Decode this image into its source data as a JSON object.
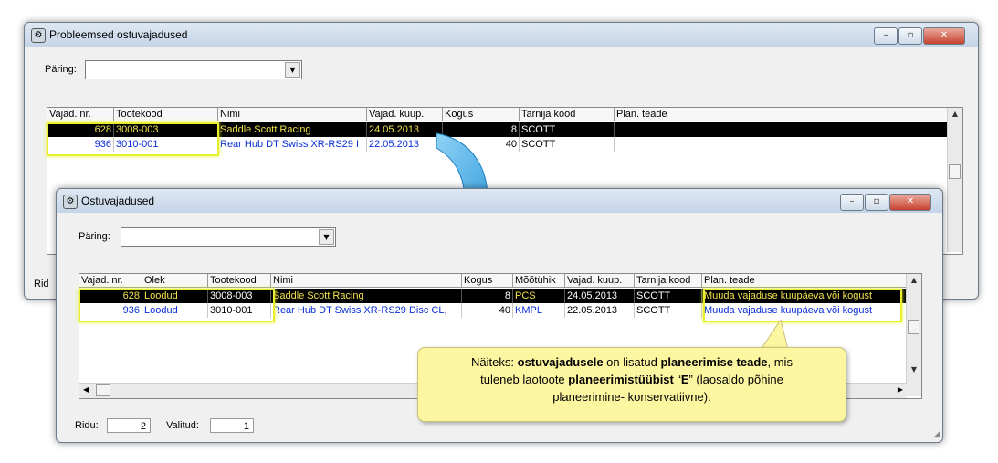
{
  "back_window": {
    "title": "Probleemsed ostuvajadused",
    "query_label": "Päring:",
    "query_value": "",
    "columns": [
      "Vajad. nr.",
      "Tootekood",
      "Nimi",
      "Vajad. kuup.",
      "Kogus",
      "Tarnija kood",
      "Plan. teade"
    ],
    "rows": [
      {
        "nr": "628",
        "code": "3008-003",
        "name": "Saddle Scott Racing",
        "date": "24.05.2013",
        "qty": "8",
        "supplier": "SCOTT",
        "plan": ""
      },
      {
        "nr": "936",
        "code": "3010-001",
        "name": "Rear Hub DT Swiss XR-RS29 I",
        "date": "22.05.2013",
        "qty": "40",
        "supplier": "SCOTT",
        "plan": ""
      }
    ],
    "status_label": "Rid"
  },
  "front_window": {
    "title": "Ostuvajadused",
    "query_label": "Päring:",
    "query_value": "",
    "columns": [
      "Vajad. nr.",
      "Olek",
      "Tootekood",
      "Nimi",
      "Kogus",
      "Mõõtühik",
      "Vajad. kuup.",
      "Tarnija kood",
      "Plan. teade"
    ],
    "rows": [
      {
        "nr": "628",
        "state": "Loodud",
        "code": "3008-003",
        "name": "Saddle Scott Racing",
        "qty": "8",
        "unit": "PCS",
        "date": "24.05.2013",
        "supplier": "SCOTT",
        "plan": "Muuda vajaduse kuupäeva või kogust"
      },
      {
        "nr": "936",
        "state": "Loodud",
        "code": "3010-001",
        "name": "Rear Hub DT Swiss XR-RS29 Disc CL,",
        "qty": "40",
        "unit": "KMPL",
        "date": "22.05.2013",
        "supplier": "SCOTT",
        "plan": "Muuda vajaduse kuupäeva või kogust"
      }
    ],
    "status": {
      "rows_label": "Ridu:",
      "rows_value": "2",
      "selected_label": "Valitud:",
      "selected_value": "1"
    }
  },
  "window_controls": {
    "minimize": "–",
    "maximize": "▫",
    "close": "✕"
  },
  "callout": {
    "line1_pre": "Näiteks: ",
    "line1_b1": "ostuvajadusele",
    "line1_mid": " on lisatud ",
    "line1_b2": "planeerimise teade",
    "line1_post": ", mis",
    "line2_pre": "tuleneb laotoote ",
    "line2_b1": "planeerimistüübist",
    "line2_q1": " “",
    "line2_b2": "E",
    "line2_q2": "” (laosaldo põhine",
    "line3": "planeerimine- konservatiivne)."
  },
  "colors": {
    "highlight": "#e8f02e",
    "selected_row_bg": "#000000",
    "selected_row_text": "#f2e24a",
    "link_text": "#0a2fd8",
    "arrow": "#2fa4e0"
  }
}
